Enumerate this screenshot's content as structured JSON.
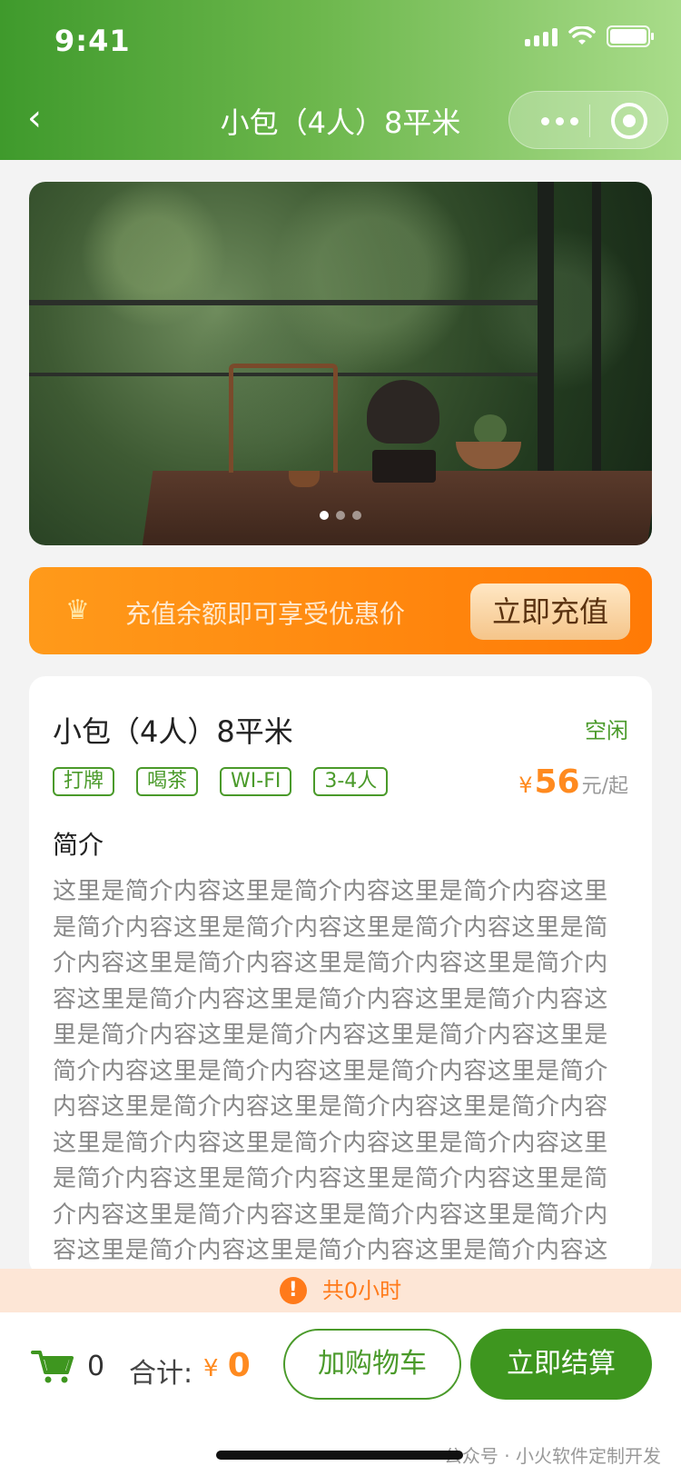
{
  "status_bar": {
    "time": "9:41"
  },
  "nav": {
    "title": "小包（4人）8平米"
  },
  "banner": {
    "slide_count": 3,
    "active_slide": 0
  },
  "recharge": {
    "text": "充值余额即可享受优惠价",
    "button_label": "立即充值"
  },
  "room": {
    "name": "小包（4人）8平米",
    "status": "空闲",
    "tags": [
      "打牌",
      "喝茶",
      "WI-FI",
      "3-4人"
    ],
    "price": {
      "symbol": "¥",
      "value": "56",
      "unit": "元/起"
    },
    "intro_title": "简介",
    "intro_text": "这里是简介内容这里是简介内容这里是简介内容这里是简介内容这里是简介内容这里是简介内容这里是简介内容这里是简介内容这里是简介内容这里是简介内容这里是简介内容这里是简介内容这里是简介内容这里是简介内容这里是简介内容这里是简介内容这里是简介内容这里是简介内容这里是简介内容这里是简介内容这里是简介内容这里是简介内容这里是简介内容这里是简介内容这里是简介内容这里是简介内容这里是简介内容这里是简介内容这里是简介内容这里是简介内容这里是简介内容这里是简介内容这里是简介内容这里是简介内容这里是简介内容这里是简介内容这里是简介内容这里是简介内容这里是简介内容这里是简介内容这里是简介内容"
  },
  "notice": {
    "icon": "!",
    "text": "共0小时"
  },
  "bottom": {
    "cart_count": "0",
    "total_label": "合计:",
    "total_symbol": "¥",
    "total_value": "0",
    "add_cart_label": "加购物车",
    "checkout_label": "立即结算"
  },
  "footer_mark": "公众号 · 小火软件定制开发",
  "colors": {
    "primary": "#3e961f",
    "accent": "#ff8a1f",
    "notice_bg": "#fde6d6"
  }
}
